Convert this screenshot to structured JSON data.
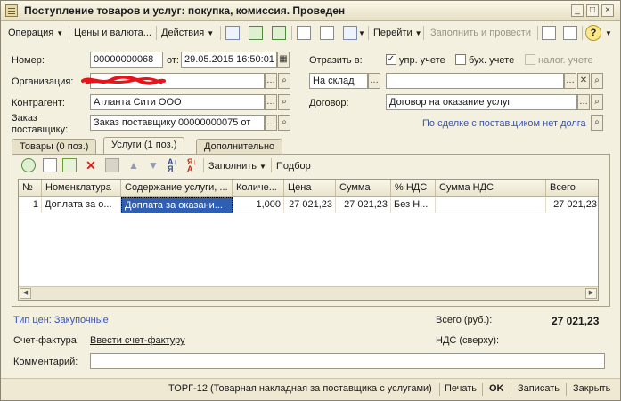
{
  "window": {
    "title": "Поступление товаров и услуг: покупка, комиссия. Проведен",
    "minimize": "_",
    "maximize": "□",
    "close": "×"
  },
  "toolbar": {
    "operation": "Операция",
    "prices_currency": "Цены и валюта...",
    "actions": "Действия",
    "goto": "Перейти",
    "fill_and_post": "Заполнить и провести",
    "help": "?"
  },
  "header": {
    "number_label": "Номер:",
    "number_value": "00000000068",
    "date_label": "от:",
    "date_value": "29.05.2015 16:50:01",
    "reflect_label": "Отразить в:",
    "mgmt_label": "упр. учете",
    "mgmt_checked": "✓",
    "acct_label": "бух. учете",
    "tax_label": "налог. учете",
    "org_label": "Организация:",
    "warehouse_value": "На склад",
    "counterparty_label": "Контрагент:",
    "counterparty_value": "Атланта Сити ООО",
    "contract_label": "Договор:",
    "contract_value": "Договор на оказание услуг",
    "order_label_1": "Заказ",
    "order_label_2": "поставщику:",
    "order_value": "Заказ поставщику 00000000075 от",
    "deal_link": "По сделке с поставщиком нет долга"
  },
  "tabs": [
    {
      "label": "Товары (0 поз.)"
    },
    {
      "label": "Услуги (1 поз.)"
    },
    {
      "label": "Дополнительно"
    }
  ],
  "panel_toolbar": {
    "fill": "Заполнить",
    "select": "Подбор"
  },
  "grid": {
    "columns": [
      "№",
      "Номенклатура",
      "Содержание услуги, ...",
      "Количе...",
      "Цена",
      "Сумма",
      "% НДС",
      "Сумма НДС",
      "Всего"
    ],
    "rows": [
      [
        "1",
        "Доплата за о...",
        "Доплата за оказани...",
        "1,000",
        "27 021,23",
        "27 021,23",
        "Без Н...",
        "",
        "27 021,23"
      ]
    ]
  },
  "footer": {
    "price_type": "Тип цен: Закупочные",
    "total_label": "Всего (руб.):",
    "total_value": "27 021,23",
    "invoice_label": "Счет-фактура:",
    "invoice_link": "Ввести счет-фактуру",
    "vat_label": "НДС (сверху):",
    "comment_label": "Комментарий:"
  },
  "bottom": {
    "torg": "ТОРГ-12 (Товарная накладная за поставщика с услугами)",
    "print": "Печать",
    "ok": "OK",
    "save": "Записать",
    "close": "Закрыть"
  },
  "colors": {
    "accent_selection": "#2f5fb3",
    "link": "#3a55a8",
    "scribble": "#e8141a"
  }
}
